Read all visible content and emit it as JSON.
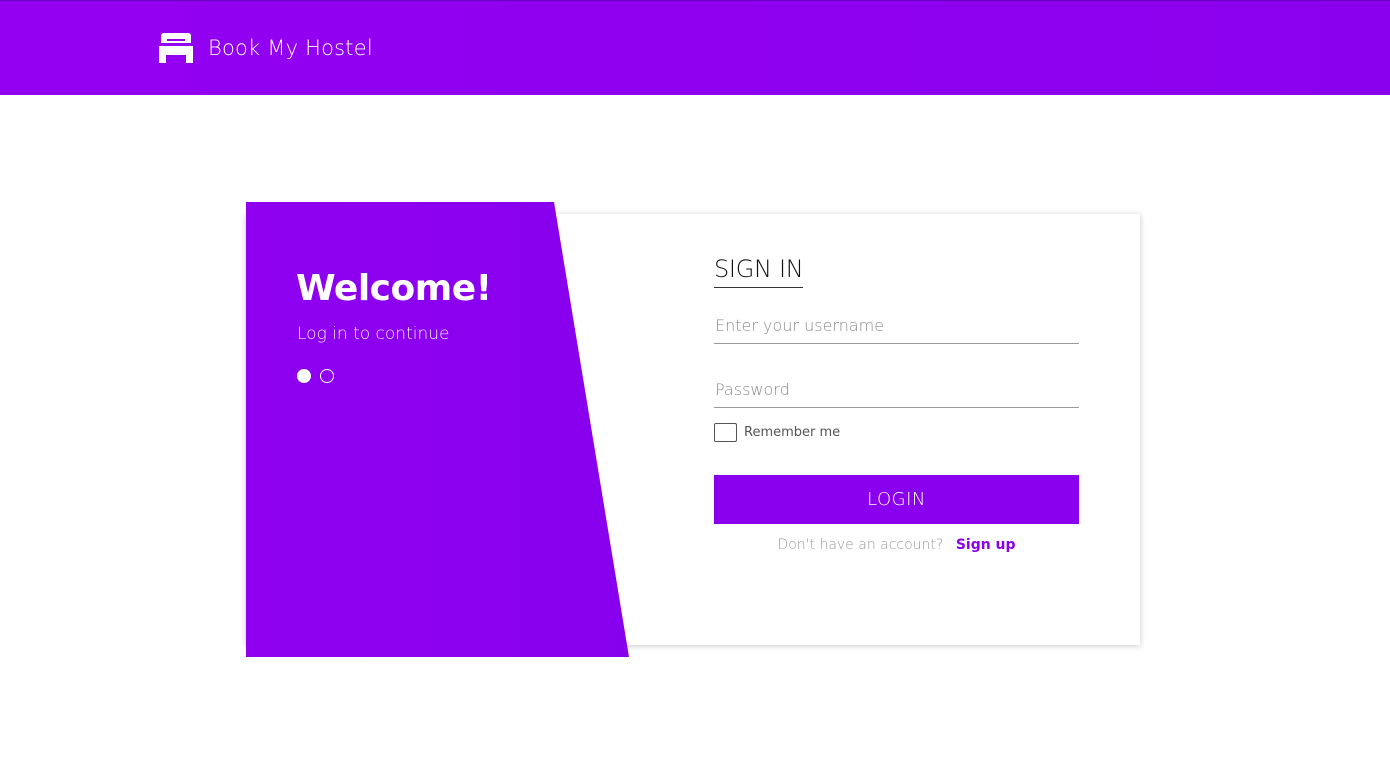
{
  "header": {
    "brand_name": "Book My Hostel",
    "logo_icon": "bed-icon",
    "background_color": "#9400f2"
  },
  "welcome_panel": {
    "title": "Welcome!",
    "subtitle": "Log in to continue",
    "carousel": {
      "total": 2,
      "active": 1
    },
    "color": "#8a00ee"
  },
  "signin_form": {
    "title": "SIGN IN",
    "username": {
      "placeholder": "Enter your username",
      "value": ""
    },
    "password": {
      "placeholder": "Password",
      "value": ""
    },
    "remember_me": {
      "label": "Remember me",
      "checked": false
    },
    "login_button_label": "LOGIN",
    "signup_prompt": "Don't have an account?",
    "signup_link_label": "Sign up",
    "accent_color": "#8a00ee"
  }
}
